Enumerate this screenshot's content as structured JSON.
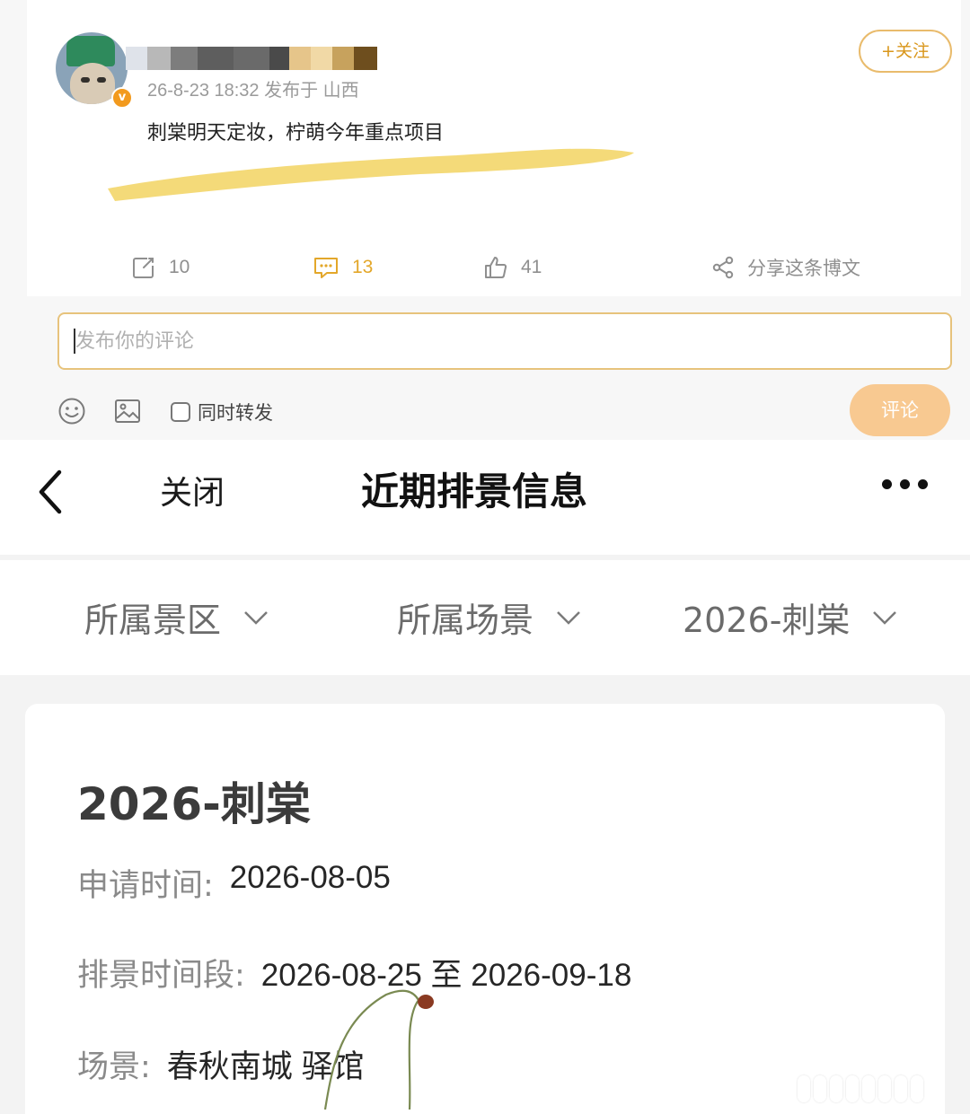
{
  "post": {
    "meta": "26-8-23 18:32 发布于 山西",
    "text": "刺棠明天定妆，柠萌今年重点项目",
    "follow_label": "+关注",
    "verified_mark": "v",
    "actions": {
      "repost_count": "10",
      "comment_count": "13",
      "like_count": "41",
      "share_label": "分享这条博文"
    },
    "comment_placeholder": "发布你的评论",
    "repost_checkbox_label": "同时转发",
    "submit_label": "评论",
    "accent_color": "#e3a72a",
    "highlight_color": "#f3d66a"
  },
  "schedule": {
    "nav": {
      "close_label": "关闭",
      "title": "近期排景信息"
    },
    "filters": [
      {
        "label": "所属景区"
      },
      {
        "label": "所属场景"
      },
      {
        "label": "2026-刺棠"
      }
    ],
    "card": {
      "title": "2026-刺棠",
      "apply_time_key": "申请时间:",
      "apply_time_value": "2026-08-05",
      "period_key": "排景时间段:",
      "period_value": "2026-08-25 至 2026-09-18",
      "scene_key": "场景:",
      "scene_value": "春秋南城 驿馆"
    }
  },
  "icons": [
    "repost-icon",
    "comment-icon",
    "like-icon",
    "share-icon",
    "emoji-icon",
    "image-icon",
    "back-chevron-icon",
    "more-icon",
    "chevron-down-icon"
  ]
}
